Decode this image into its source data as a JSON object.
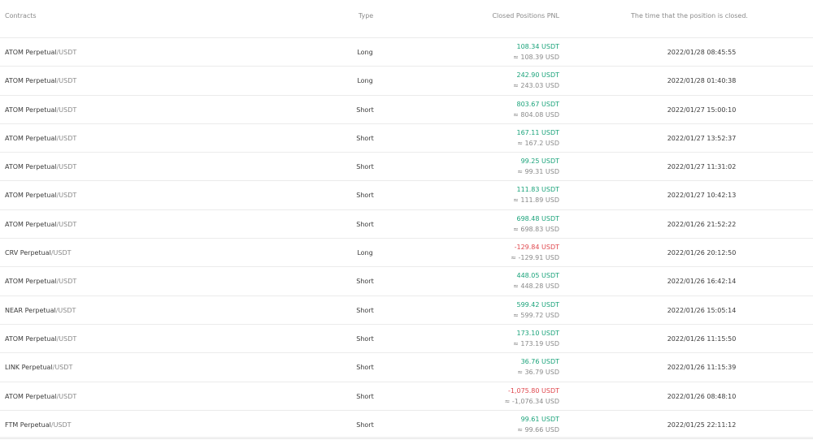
{
  "headers": {
    "contracts": "Contracts",
    "type": "Type",
    "pnl": "Closed Positions PNL",
    "time": "The time that the position is closed."
  },
  "rows": [
    {
      "symbol": "ATOM Perpetual",
      "quote": "/USDT",
      "type": "Long",
      "pnl": "108.34 USDT",
      "usd": "≈ 108.39 USD",
      "sign": "pos",
      "time": "2022/01/28 08:45:55"
    },
    {
      "symbol": "ATOM Perpetual",
      "quote": "/USDT",
      "type": "Long",
      "pnl": "242.90 USDT",
      "usd": "≈ 243.03 USD",
      "sign": "pos",
      "time": "2022/01/28 01:40:38"
    },
    {
      "symbol": "ATOM Perpetual",
      "quote": "/USDT",
      "type": "Short",
      "pnl": "803.67 USDT",
      "usd": "≈ 804.08 USD",
      "sign": "pos",
      "time": "2022/01/27 15:00:10"
    },
    {
      "symbol": "ATOM Perpetual",
      "quote": "/USDT",
      "type": "Short",
      "pnl": "167.11 USDT",
      "usd": "≈ 167.2 USD",
      "sign": "pos",
      "time": "2022/01/27 13:52:37"
    },
    {
      "symbol": "ATOM Perpetual",
      "quote": "/USDT",
      "type": "Short",
      "pnl": "99.25 USDT",
      "usd": "≈ 99.31 USD",
      "sign": "pos",
      "time": "2022/01/27 11:31:02"
    },
    {
      "symbol": "ATOM Perpetual",
      "quote": "/USDT",
      "type": "Short",
      "pnl": "111.83 USDT",
      "usd": "≈ 111.89 USD",
      "sign": "pos",
      "time": "2022/01/27 10:42:13"
    },
    {
      "symbol": "ATOM Perpetual",
      "quote": "/USDT",
      "type": "Short",
      "pnl": "698.48 USDT",
      "usd": "≈ 698.83 USD",
      "sign": "pos",
      "time": "2022/01/26 21:52:22"
    },
    {
      "symbol": "CRV Perpetual",
      "quote": "/USDT",
      "type": "Long",
      "pnl": "-129.84 USDT",
      "usd": "≈ -129.91 USD",
      "sign": "neg",
      "time": "2022/01/26 20:12:50"
    },
    {
      "symbol": "ATOM Perpetual",
      "quote": "/USDT",
      "type": "Short",
      "pnl": "448.05 USDT",
      "usd": "≈ 448.28 USD",
      "sign": "pos",
      "time": "2022/01/26 16:42:14"
    },
    {
      "symbol": "NEAR Perpetual",
      "quote": "/USDT",
      "type": "Short",
      "pnl": "599.42 USDT",
      "usd": "≈ 599.72 USD",
      "sign": "pos",
      "time": "2022/01/26 15:05:14"
    },
    {
      "symbol": "ATOM Perpetual",
      "quote": "/USDT",
      "type": "Short",
      "pnl": "173.10 USDT",
      "usd": "≈ 173.19 USD",
      "sign": "pos",
      "time": "2022/01/26 11:15:50"
    },
    {
      "symbol": "LINK Perpetual",
      "quote": "/USDT",
      "type": "Short",
      "pnl": "36.76 USDT",
      "usd": "≈ 36.79 USD",
      "sign": "pos",
      "time": "2022/01/26 11:15:39"
    },
    {
      "symbol": "ATOM Perpetual",
      "quote": "/USDT",
      "type": "Short",
      "pnl": "-1,075.80 USDT",
      "usd": "≈ -1,076.34 USD",
      "sign": "neg",
      "time": "2022/01/26 08:48:10"
    },
    {
      "symbol": "FTM Perpetual",
      "quote": "/USDT",
      "type": "Short",
      "pnl": "99.61 USDT",
      "usd": "≈ 99.66 USD",
      "sign": "pos",
      "time": "2022/01/25 22:11:12"
    }
  ],
  "colors": {
    "positive": "#1aa37a",
    "negative": "#e0484e"
  }
}
